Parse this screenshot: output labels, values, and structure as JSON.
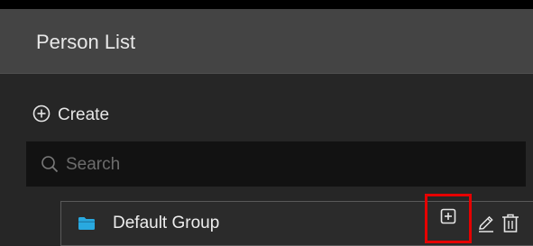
{
  "header": {
    "title": "Person List"
  },
  "toolbar": {
    "create_label": "Create"
  },
  "search": {
    "placeholder": "Search",
    "value": ""
  },
  "groups": [
    {
      "name": "Default Group",
      "icon": "folder-icon"
    }
  ],
  "icons": {
    "create": "plus-circle-icon",
    "search": "search-icon",
    "add": "plus-square-icon",
    "edit": "pencil-icon",
    "delete": "trash-icon"
  },
  "colors": {
    "highlight": "#e60000",
    "folder": "#29a9e0",
    "header_bg": "#444444",
    "panel_bg": "#262626",
    "search_bg": "#121212"
  }
}
